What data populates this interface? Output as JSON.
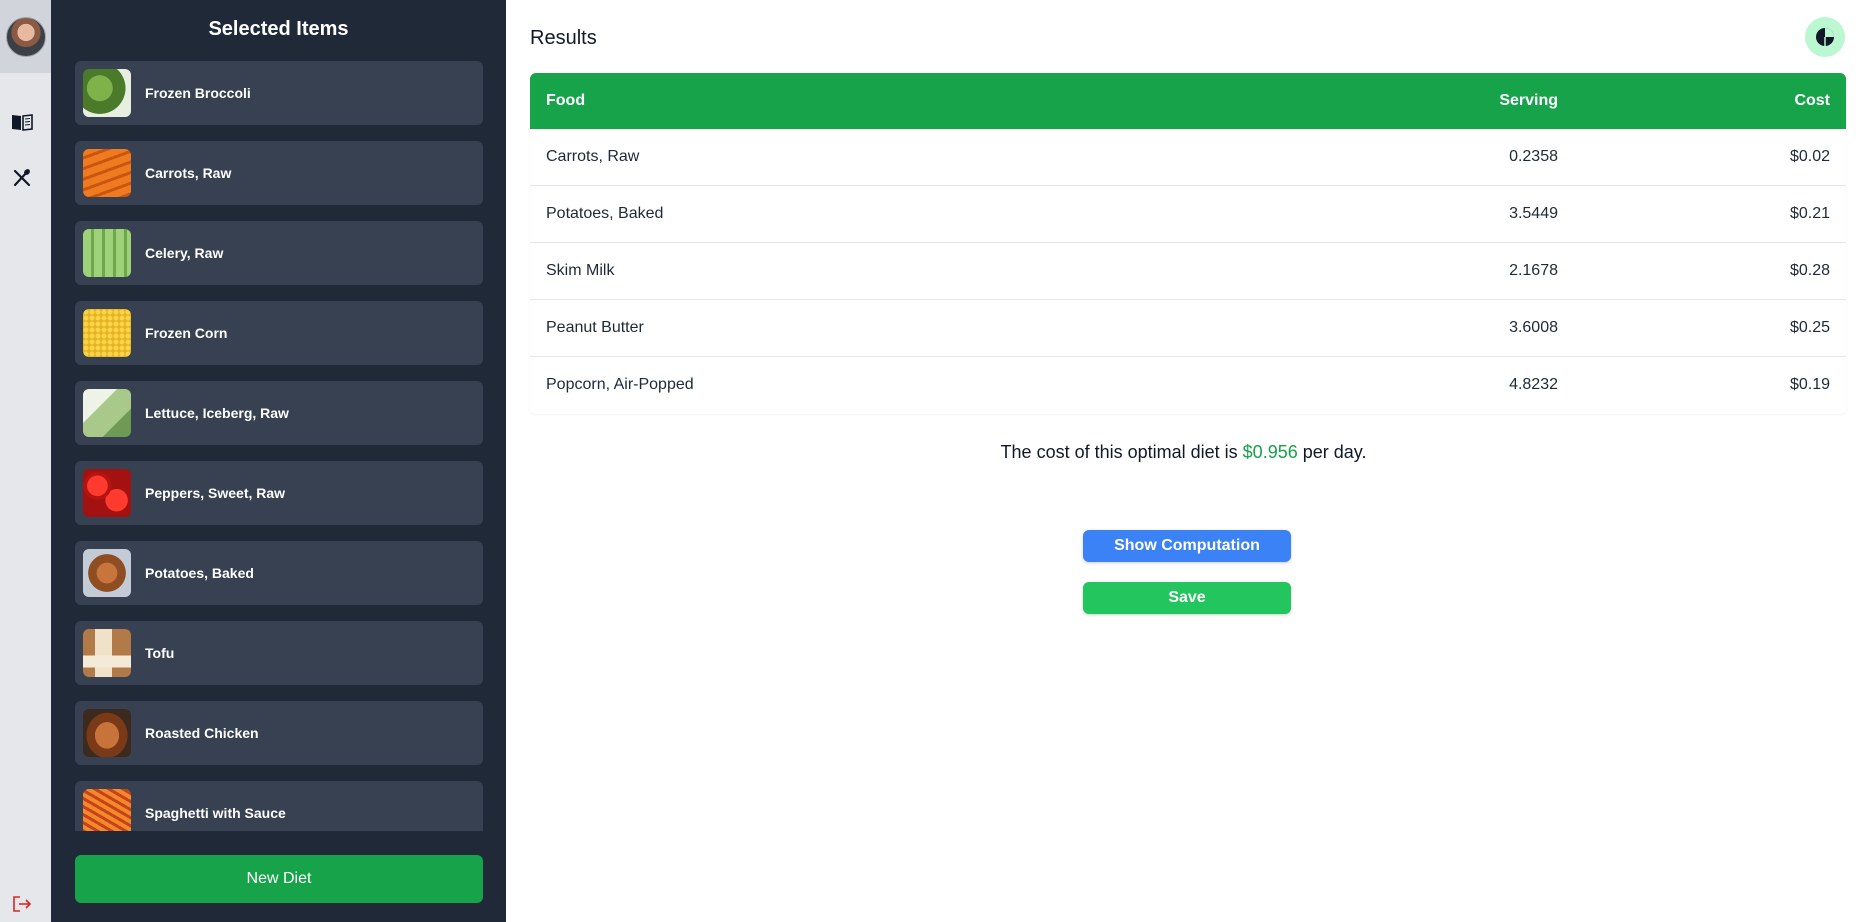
{
  "sidebar": {
    "title": "Selected Items",
    "items": [
      {
        "label": "Frozen Broccoli",
        "color": "#5a8f3a"
      },
      {
        "label": "Carrots, Raw",
        "color": "#e86a1c"
      },
      {
        "label": "Celery, Raw",
        "color": "#8fc46a"
      },
      {
        "label": "Frozen Corn",
        "color": "#f2c230"
      },
      {
        "label": "Lettuce, Iceberg, Raw",
        "color": "#a8c98a"
      },
      {
        "label": "Peppers, Sweet, Raw",
        "color": "#d0201c"
      },
      {
        "label": "Potatoes, Baked",
        "color": "#b06a3a"
      },
      {
        "label": "Tofu",
        "color": "#c79a68"
      },
      {
        "label": "Roasted Chicken",
        "color": "#8a4b22"
      },
      {
        "label": "Spaghetti with Sauce",
        "color": "#d9531e"
      }
    ],
    "new_diet_label": "New Diet"
  },
  "main": {
    "title": "Results",
    "table": {
      "headers": [
        "Food",
        "Serving",
        "Cost"
      ],
      "rows": [
        [
          "Carrots, Raw",
          "0.2358",
          "$0.02"
        ],
        [
          "Potatoes, Baked",
          "3.5449",
          "$0.21"
        ],
        [
          "Skim Milk",
          "2.1678",
          "$0.28"
        ],
        [
          "Peanut Butter",
          "3.6008",
          "$0.25"
        ],
        [
          "Popcorn, Air-Popped",
          "4.8232",
          "$0.19"
        ]
      ]
    },
    "summary": {
      "prefix": "The cost of this optimal diet is",
      "amount": "$0.956",
      "suffix": "per day."
    },
    "show_computation_label": "Show Computation",
    "save_label": "Save"
  },
  "icons": {
    "rail": [
      "book-icon",
      "utensils-icon",
      "logout-icon"
    ],
    "header": "pie-chart-icon"
  },
  "colors": {
    "accent_green": "#16a34a",
    "button_blue": "#3b82f6",
    "sidebar_bg": "#1f2937",
    "item_bg": "#374151",
    "logout_red": "#dc2626"
  }
}
